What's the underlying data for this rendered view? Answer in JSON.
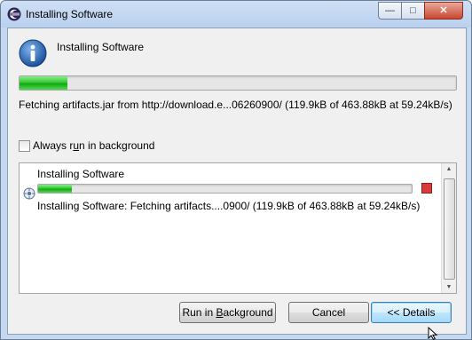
{
  "window": {
    "title": "Installing Software",
    "caption": {
      "minimize_glyph": "—",
      "maximize_glyph": "□",
      "close_glyph": "✕"
    }
  },
  "main": {
    "heading": "Installing Software",
    "progress": 0.11,
    "status": "Fetching artifacts.jar from http://download.e...06260900/ (119.9kB of 463.88kB at 59.24kB/s)"
  },
  "background_option": {
    "label_pre": "Always r",
    "label_accel": "u",
    "label_post": "n in background",
    "checked": false
  },
  "job": {
    "title": "Installing Software",
    "progress": 0.09,
    "status": "Installing Software: Fetching artifacts....0900/ (119.9kB of 463.88kB at 59.24kB/s)"
  },
  "buttons": {
    "run_pre": "Run in ",
    "run_accel": "B",
    "run_post": "ackground",
    "cancel": "Cancel",
    "details": "<< Details"
  },
  "colors": {
    "progress_green": "#12a812",
    "stop_red": "#d93a3a"
  },
  "icons": {
    "app": "eclipse-icon",
    "info": "info-icon",
    "job": "install-job-icon",
    "stop": "stop-icon"
  }
}
